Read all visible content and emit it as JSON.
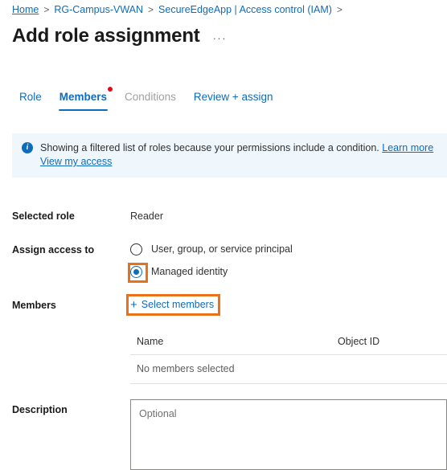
{
  "breadcrumb": {
    "items": [
      {
        "label": "Home"
      },
      {
        "label": "RG-Campus-VWAN"
      },
      {
        "label": "SecureEdgeApp | Access control (IAM)"
      }
    ],
    "separator": ">"
  },
  "header": {
    "title": "Add role assignment",
    "more_menu": "···"
  },
  "tabs": [
    {
      "label": "Role",
      "state": "normal"
    },
    {
      "label": "Members",
      "state": "active"
    },
    {
      "label": "Conditions",
      "state": "disabled"
    },
    {
      "label": "Review + assign",
      "state": "normal"
    }
  ],
  "banner": {
    "icon": "info-icon",
    "message": "Showing a filtered list of roles because your permissions include a condition.",
    "link_learn_more": "Learn more",
    "link_view_access": "View my access",
    "background": "#eff6fc",
    "accent": "#0f6cbd"
  },
  "form": {
    "selected_role": {
      "label": "Selected role",
      "value": "Reader"
    },
    "assign_access_to": {
      "label": "Assign access to",
      "options": [
        {
          "label": "User, group, or service principal",
          "selected": false
        },
        {
          "label": "Managed identity",
          "selected": true
        }
      ]
    },
    "members": {
      "label": "Members",
      "select_button": "Select members",
      "plus_icon": "+"
    },
    "description": {
      "label": "Description",
      "placeholder": "Optional",
      "value": ""
    }
  },
  "members_table": {
    "columns": [
      "Name",
      "Object ID"
    ],
    "empty_text": "No members selected",
    "rows": []
  },
  "highlights": {
    "color": "#e8711a",
    "targets": [
      "managed-identity-radio",
      "select-members-button"
    ]
  }
}
